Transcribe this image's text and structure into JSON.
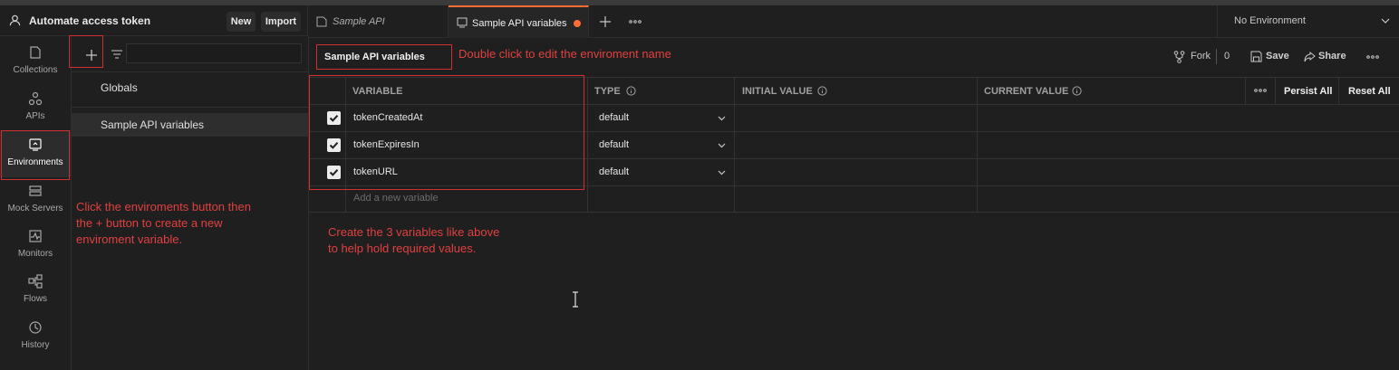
{
  "workspace": {
    "title": "Automate access token",
    "new_label": "New",
    "import_label": "Import"
  },
  "rail": {
    "items": [
      {
        "label": "Collections",
        "icon": "collections-icon"
      },
      {
        "label": "APIs",
        "icon": "apis-icon"
      },
      {
        "label": "Environments",
        "icon": "environments-icon",
        "active": true
      },
      {
        "label": "Mock Servers",
        "icon": "mock-servers-icon"
      },
      {
        "label": "Monitors",
        "icon": "monitors-icon"
      },
      {
        "label": "Flows",
        "icon": "flows-icon"
      },
      {
        "label": "History",
        "icon": "history-icon"
      }
    ]
  },
  "env_list": {
    "items": [
      "Globals",
      "Sample API variables"
    ]
  },
  "tabs": {
    "items": [
      {
        "label": "Sample API"
      },
      {
        "label": "Sample API variables",
        "active": true,
        "unsaved": true
      }
    ],
    "environment_select": "No Environment"
  },
  "toolbar": {
    "env_name": "Sample API variables",
    "fork_label": "Fork",
    "fork_count": "0",
    "save_label": "Save",
    "share_label": "Share"
  },
  "table": {
    "headers": {
      "variable": "VARIABLE",
      "type": "TYPE",
      "initial": "INITIAL VALUE",
      "current": "CURRENT VALUE",
      "persist_all": "Persist All",
      "reset_all": "Reset All"
    },
    "rows": [
      {
        "name": "tokenCreatedAt",
        "type": "default",
        "checked": true
      },
      {
        "name": "tokenExpiresIn",
        "type": "default",
        "checked": true
      },
      {
        "name": "tokenURL",
        "type": "default",
        "checked": true
      }
    ],
    "add_placeholder": "Add a new variable"
  },
  "annotations": {
    "edit_name": "Double click to edit the enviroment name",
    "env_button_1": "Click the enviroments button then",
    "env_button_2": "the + button to create a new",
    "env_button_3": "enviroment variable.",
    "vars_1": "Create the 3 variables like above",
    "vars_2": "to help hold required values."
  },
  "colors": {
    "background": "#1f1f1f",
    "accent": "#ff6c37",
    "annotation": "#e04040"
  }
}
